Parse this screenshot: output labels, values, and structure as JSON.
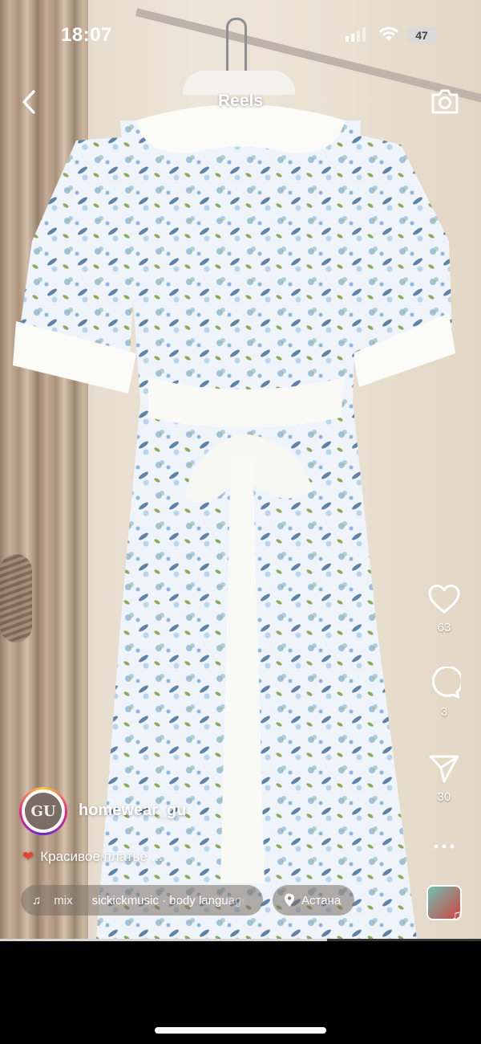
{
  "status_bar": {
    "time": "18:07",
    "battery": "47"
  },
  "header": {
    "title": "Reels"
  },
  "actions": {
    "likes": "63",
    "comments": "3",
    "shares": "30"
  },
  "profile": {
    "avatar_text": "GU",
    "username": "homewear_gu"
  },
  "caption": {
    "text": "Красивое платье ..."
  },
  "music": {
    "label": "mix",
    "track": "sickickmusic · body language"
  },
  "location": {
    "name": "Астана"
  },
  "playback": {
    "progress": 0.68
  },
  "colors": {
    "accent_heart": "#e0452f",
    "pill_bg": "rgba(120,110,100,.55)"
  }
}
